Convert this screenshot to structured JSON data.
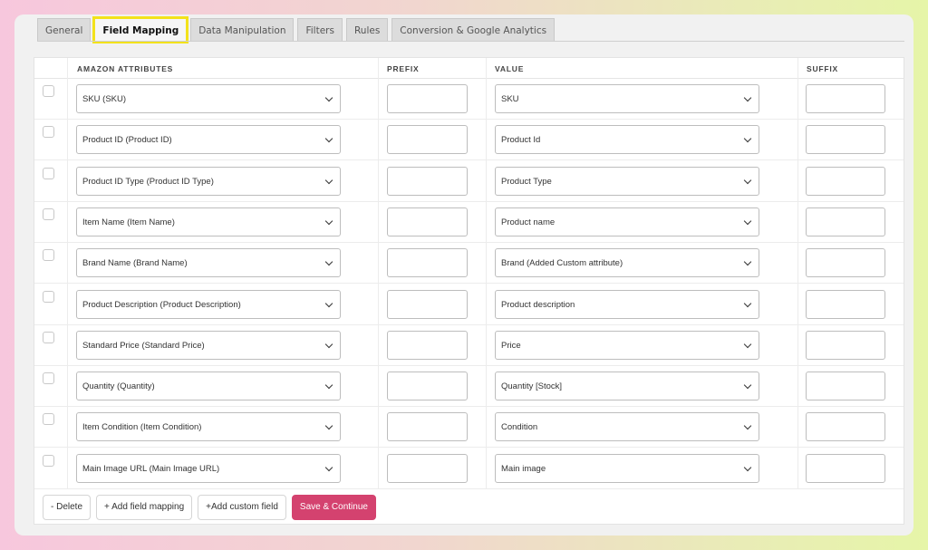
{
  "tabs": [
    {
      "label": "General",
      "active": false
    },
    {
      "label": "Field Mapping",
      "active": true
    },
    {
      "label": "Data Manipulation",
      "active": false
    },
    {
      "label": "Filters",
      "active": false
    },
    {
      "label": "Rules",
      "active": false
    },
    {
      "label": "Conversion & Google Analytics",
      "active": false
    }
  ],
  "table": {
    "headers": {
      "attributes": "AMAZON ATTRIBUTES",
      "prefix": "PREFIX",
      "value": "VALUE",
      "suffix": "SUFFIX"
    },
    "rows": [
      {
        "attribute": "SKU (SKU)",
        "prefix": "",
        "value": "SKU",
        "suffix": ""
      },
      {
        "attribute": "Product ID (Product ID)",
        "prefix": "",
        "value": "Product Id",
        "suffix": ""
      },
      {
        "attribute": "Product ID Type (Product ID Type)",
        "prefix": "",
        "value": "Product Type",
        "suffix": ""
      },
      {
        "attribute": "Item Name (Item Name)",
        "prefix": "",
        "value": "Product name",
        "suffix": ""
      },
      {
        "attribute": "Brand Name (Brand Name)",
        "prefix": "",
        "value": "Brand (Added Custom attribute)",
        "suffix": ""
      },
      {
        "attribute": "Product Description (Product Description)",
        "prefix": "",
        "value": "Product description",
        "suffix": ""
      },
      {
        "attribute": "Standard Price (Standard Price)",
        "prefix": "",
        "value": "Price",
        "suffix": ""
      },
      {
        "attribute": "Quantity (Quantity)",
        "prefix": "",
        "value": "Quantity [Stock]",
        "suffix": ""
      },
      {
        "attribute": "Item Condition (Item Condition)",
        "prefix": "",
        "value": "Condition",
        "suffix": ""
      },
      {
        "attribute": "Main Image URL (Main Image URL)",
        "prefix": "",
        "value": "Main image",
        "suffix": ""
      }
    ]
  },
  "footer": {
    "delete_label": "- Delete",
    "add_field_label": "+ Add field mapping",
    "add_custom_label": "+Add custom field",
    "save_label": "Save & Continue"
  },
  "colors": {
    "active_tab_highlight": "#f3e21b",
    "primary_button": "#d4426f"
  }
}
